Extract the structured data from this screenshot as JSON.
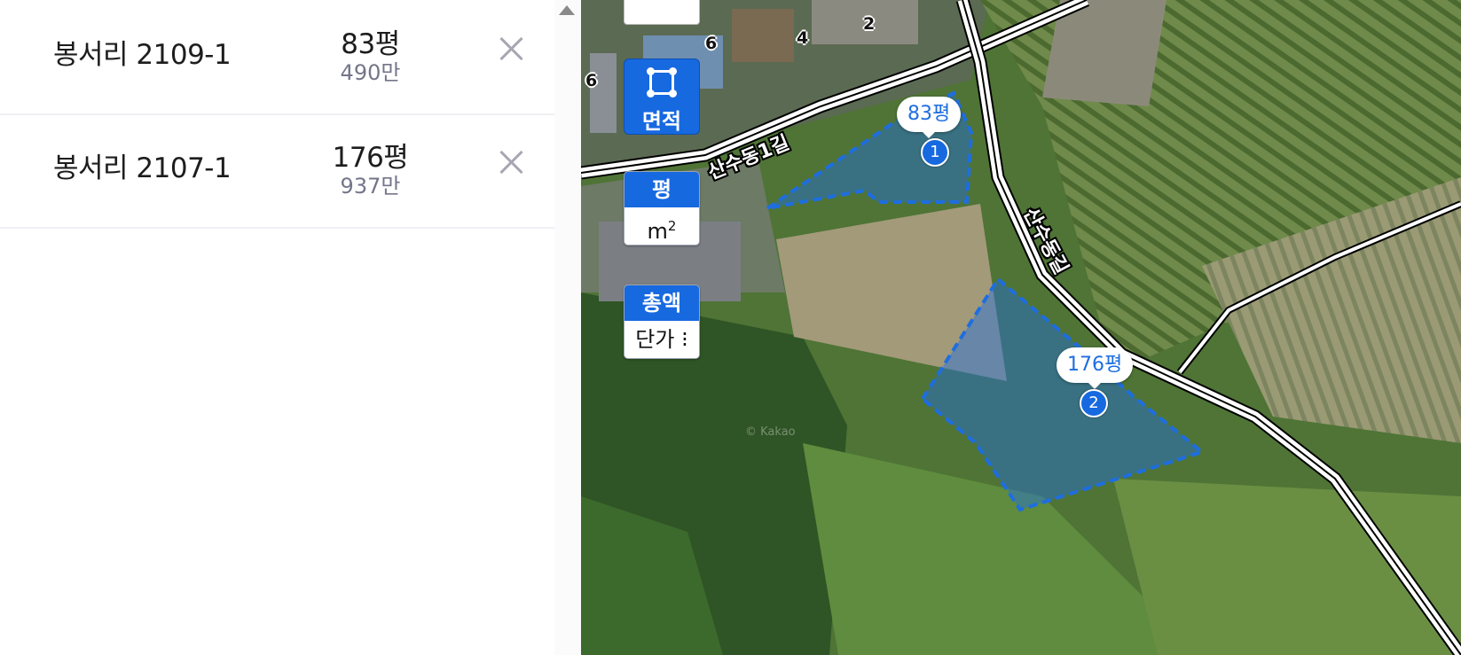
{
  "parcels": [
    {
      "name": "봉서리 2109-1",
      "area": "83평",
      "price": "490만",
      "remove_icon": "close-icon"
    },
    {
      "name": "봉서리 2107-1",
      "area": "176평",
      "price": "937만",
      "remove_icon": "close-icon"
    }
  ],
  "map": {
    "controls": {
      "area_tool_label": "면적",
      "unit_active": "평",
      "unit_inactive": "m",
      "unit_inactive_sup": "2",
      "price_active": "총액",
      "price_inactive": "단가 ⁝"
    },
    "markers": [
      {
        "area": "83평",
        "index": "1"
      },
      {
        "area": "176평",
        "index": "2"
      }
    ],
    "road_labels": [
      "산수동1길",
      "산수동길"
    ],
    "building_numbers": [
      "6",
      "4",
      "2",
      "6"
    ],
    "watermark": "© Kakao",
    "parcel_color": "#1e6ee0"
  }
}
